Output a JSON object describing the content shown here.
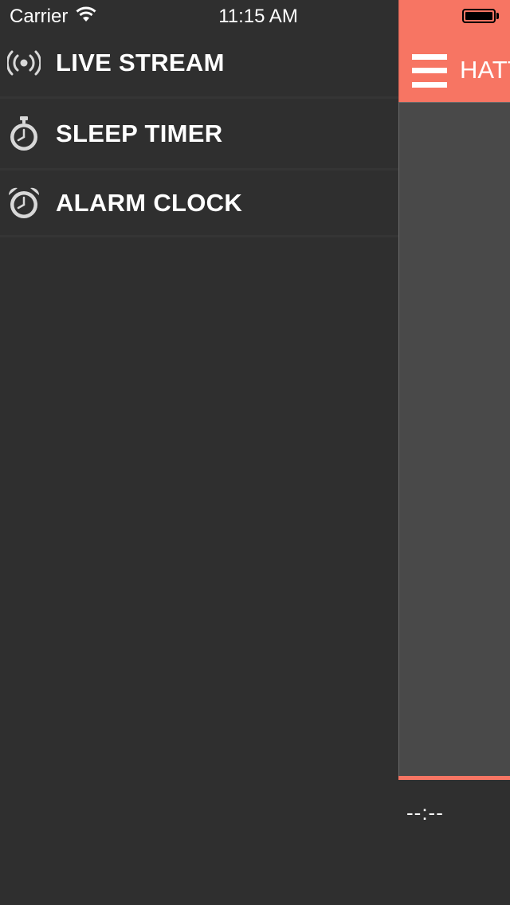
{
  "status_bar": {
    "carrier": "Carrier",
    "time": "11:15 AM",
    "wifi_icon": "wifi-icon",
    "battery_icon": "battery-icon"
  },
  "menu": {
    "items": [
      {
        "label": "LIVE STREAM",
        "icon": "broadcast-icon"
      },
      {
        "label": "SLEEP TIMER",
        "icon": "stopwatch-icon"
      },
      {
        "label": "ALARM CLOCK",
        "icon": "alarm-clock-icon"
      }
    ]
  },
  "header": {
    "title": "HATT",
    "menu_icon": "hamburger-menu-icon"
  },
  "player": {
    "time": "--:--"
  },
  "colors": {
    "menu_bg": "#2f2f2f",
    "accent": "#f77563",
    "content_bg": "#494949",
    "text": "#ffffff",
    "icon": "#d8d8d8"
  }
}
